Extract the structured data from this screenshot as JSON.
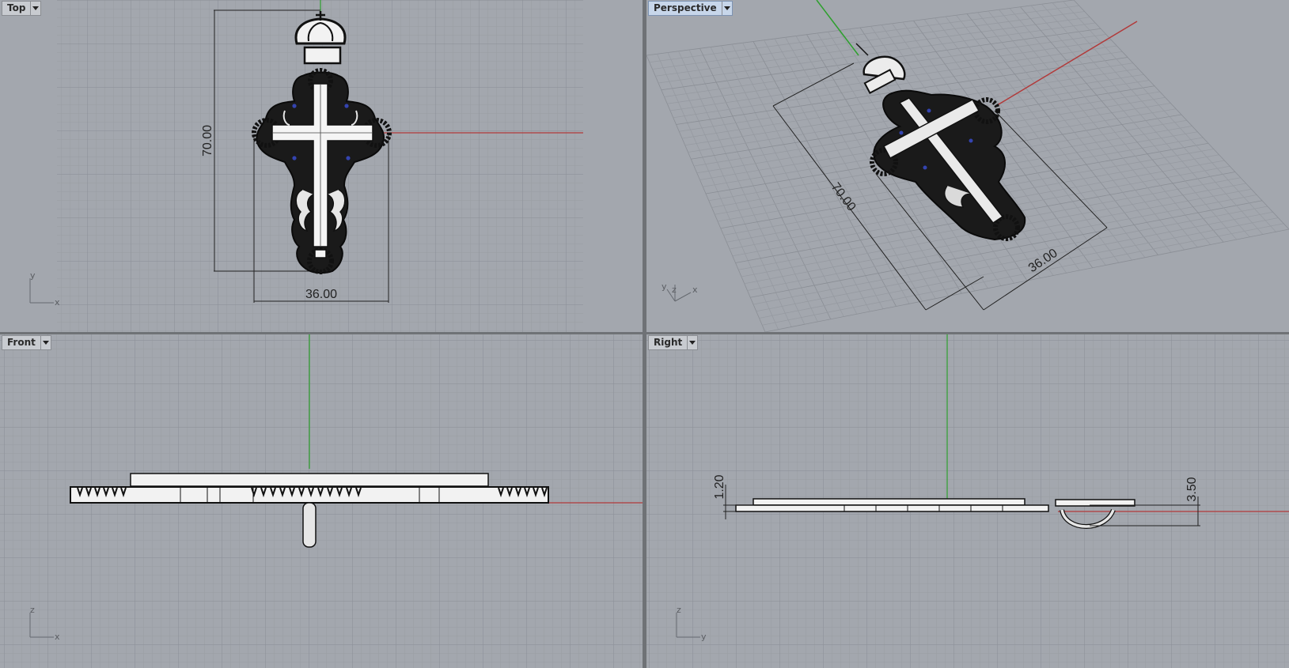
{
  "viewports": {
    "top": {
      "label": "Top"
    },
    "perspective": {
      "label": "Perspective"
    },
    "front": {
      "label": "Front"
    },
    "right": {
      "label": "Right"
    }
  },
  "dimensions": {
    "height": "70.00",
    "width": "36.00",
    "thickness": "1.20",
    "bail_height": "3.50"
  },
  "axes": {
    "top": [
      "y",
      "x"
    ],
    "perspective": [
      "y",
      "z",
      "x"
    ],
    "front": [
      "z",
      "x"
    ],
    "right": [
      "z",
      "y"
    ]
  },
  "colors": {
    "viewport_bg": "#a3a7ae",
    "grid_minor": "#9a9ea5",
    "grid_major": "#8b8f96",
    "x_axis": "#b23a3a",
    "y_axis": "#2ea02e",
    "active_label": "#c7d6ea"
  }
}
